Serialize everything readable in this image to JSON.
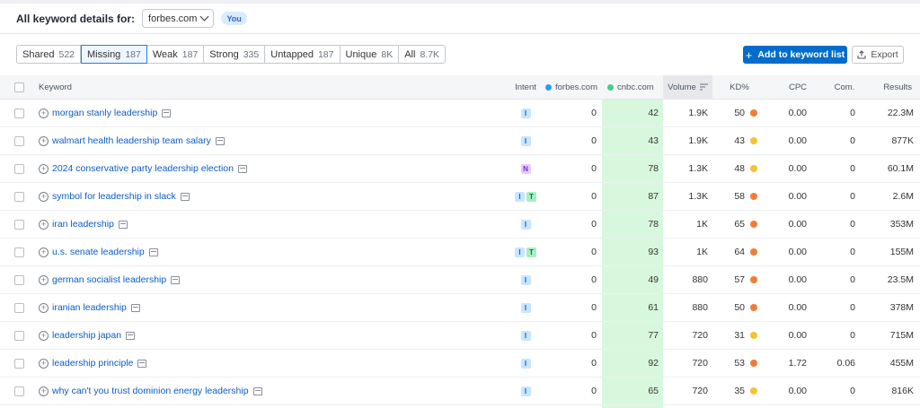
{
  "header": {
    "label": "All keyword details for:",
    "domain": "forbes.com",
    "you_badge": "You"
  },
  "filters": [
    {
      "label": "Shared",
      "count": "522",
      "active": false
    },
    {
      "label": "Missing",
      "count": "187",
      "active": true
    },
    {
      "label": "Weak",
      "count": "187",
      "active": false
    },
    {
      "label": "Strong",
      "count": "335",
      "active": false
    },
    {
      "label": "Untapped",
      "count": "187",
      "active": false
    },
    {
      "label": "Unique",
      "count": "8K",
      "active": false
    },
    {
      "label": "All",
      "count": "8.7K",
      "active": false
    }
  ],
  "toolbar": {
    "add_label": "Add to keyword list",
    "export_label": "Export"
  },
  "columns": {
    "keyword": "Keyword",
    "intent": "Intent",
    "forbes": "forbes.com",
    "cnbc": "cnbc.com",
    "volume": "Volume",
    "kd": "KD%",
    "cpc": "CPC",
    "com": "Com.",
    "results": "Results"
  },
  "colors": {
    "forbes_dot": "#2a9df4",
    "cnbc_dot": "#3fcf8e",
    "kd_orange": "#f07d36",
    "kd_yellow": "#f4c430"
  },
  "rows": [
    {
      "keyword": "morgan stanly leadership",
      "intent": [
        "I"
      ],
      "forbes": "0",
      "cnbc": "42",
      "volume": "1.9K",
      "kd": "50",
      "kd_color": "#f07d36",
      "cpc": "0.00",
      "com": "0",
      "results": "22.3M"
    },
    {
      "keyword": "walmart health leadership team salary",
      "intent": [
        "I"
      ],
      "forbes": "0",
      "cnbc": "43",
      "volume": "1.9K",
      "kd": "43",
      "kd_color": "#f4c430",
      "cpc": "0.00",
      "com": "0",
      "results": "877K"
    },
    {
      "keyword": "2024 conservative party leadership election",
      "intent": [
        "N"
      ],
      "forbes": "0",
      "cnbc": "78",
      "volume": "1.3K",
      "kd": "48",
      "kd_color": "#f4c430",
      "cpc": "0.00",
      "com": "0",
      "results": "60.1M"
    },
    {
      "keyword": "symbol for leadership in slack",
      "intent": [
        "I",
        "T"
      ],
      "forbes": "0",
      "cnbc": "87",
      "volume": "1.3K",
      "kd": "58",
      "kd_color": "#f07d36",
      "cpc": "0.00",
      "com": "0",
      "results": "2.6M"
    },
    {
      "keyword": "iran leadership",
      "intent": [
        "I"
      ],
      "forbes": "0",
      "cnbc": "78",
      "volume": "1K",
      "kd": "65",
      "kd_color": "#f07d36",
      "cpc": "0.00",
      "com": "0",
      "results": "353M"
    },
    {
      "keyword": "u.s. senate leadership",
      "intent": [
        "I",
        "T"
      ],
      "forbes": "0",
      "cnbc": "93",
      "volume": "1K",
      "kd": "64",
      "kd_color": "#f07d36",
      "cpc": "0.00",
      "com": "0",
      "results": "155M"
    },
    {
      "keyword": "german socialist leadership",
      "intent": [
        "I"
      ],
      "forbes": "0",
      "cnbc": "49",
      "volume": "880",
      "kd": "57",
      "kd_color": "#f07d36",
      "cpc": "0.00",
      "com": "0",
      "results": "23.5M"
    },
    {
      "keyword": "iranian leadership",
      "intent": [
        "I"
      ],
      "forbes": "0",
      "cnbc": "61",
      "volume": "880",
      "kd": "50",
      "kd_color": "#f07d36",
      "cpc": "0.00",
      "com": "0",
      "results": "378M"
    },
    {
      "keyword": "leadership japan",
      "intent": [
        "I"
      ],
      "forbes": "0",
      "cnbc": "77",
      "volume": "720",
      "kd": "31",
      "kd_color": "#f4c430",
      "cpc": "0.00",
      "com": "0",
      "results": "715M"
    },
    {
      "keyword": "leadership principle",
      "intent": [
        "I"
      ],
      "forbes": "0",
      "cnbc": "92",
      "volume": "720",
      "kd": "53",
      "kd_color": "#f07d36",
      "cpc": "1.72",
      "com": "0.06",
      "results": "455M"
    },
    {
      "keyword": "why can't you trust dominion energy leadership",
      "intent": [
        "I"
      ],
      "forbes": "0",
      "cnbc": "65",
      "volume": "720",
      "kd": "35",
      "kd_color": "#f4c430",
      "cpc": "0.00",
      "com": "0",
      "results": "816K"
    }
  ]
}
